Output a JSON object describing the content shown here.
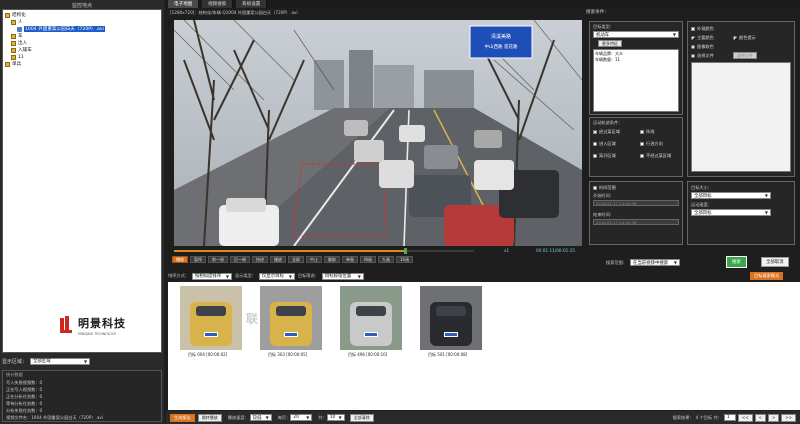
{
  "left_panel": {
    "title": "监控地点",
    "tree": [
      {
        "label": "结构化",
        "level": 0,
        "icon": "folder-icon"
      },
      {
        "label": "人",
        "level": 1,
        "icon": "folder-icon"
      },
      {
        "label": "1004 外国重案公园白天（720P）.avi",
        "level": 2,
        "icon": "camera-icon",
        "selected": true
      },
      {
        "label": "车",
        "level": 1,
        "icon": "folder-icon"
      },
      {
        "label": "出入",
        "level": 1,
        "icon": "folder-icon"
      },
      {
        "label": "入辅车",
        "level": 1,
        "icon": "folder-icon"
      },
      {
        "label": "11",
        "level": 1,
        "icon": "folder-icon"
      },
      {
        "label": "单兵",
        "level": 0,
        "icon": "folder-icon"
      }
    ],
    "logo": {
      "cn": "明景科技",
      "en": "MINGJING TECHNOLOGY"
    },
    "show_region_label": "显示区域：",
    "show_region_value": "全部区域",
    "stats_title": "统计数据",
    "stats": [
      {
        "label": "写入失败视频数：",
        "value": "0"
      },
      {
        "label": "正在写入视频数：",
        "value": "0"
      },
      {
        "label": "正在分析任务数：",
        "value": "0"
      },
      {
        "label": "等待分析任务数：",
        "value": "0"
      },
      {
        "label": "分析失败任务数：",
        "value": "0"
      },
      {
        "label": "视频文件名：",
        "value": "1004 外国重案公园白天（720P）.avi"
      }
    ]
  },
  "tabs": [
    {
      "label": "电子地图",
      "active": true
    },
    {
      "label": "视频搜索",
      "active": false
    },
    {
      "label": "系统设置",
      "active": false
    }
  ],
  "video": {
    "title": "[1280x720]：结构化/车辆-Q1004 外国重案公园白天（720P）.avi",
    "sign_line1": "清溪美路",
    "sign_line2": "中山西路  莲花路",
    "progress": 0.77,
    "speed": "x1",
    "time": "00:01:11/00:01:25"
  },
  "controls": [
    "播放",
    "暂停",
    "前一帧",
    "后一帧",
    "快进",
    "慢放",
    "全屏",
    "中止",
    "截取",
    "单画",
    "四画",
    "九画",
    "16画"
  ],
  "right_panel": {
    "title": "搜索条件：",
    "target_type_label": "目标类型：",
    "target_type_value": "机动车",
    "more_features_btn": "更多特征",
    "plate_label": "车辆品牌：大众",
    "plate_count": "车辆数量：11",
    "region_cond_label": "运动轨迹条件：",
    "checks": [
      {
        "label": "经过某区域",
        "on": true
      },
      {
        "label": "拌线",
        "on": false
      },
      {
        "label": "进入区域",
        "on": false
      },
      {
        "label": "行进方向",
        "on": false
      },
      {
        "label": "离开区域",
        "on": false
      },
      {
        "label": "不经过某区域",
        "on": false
      }
    ],
    "time_range_label": "时间范围",
    "start_label": "开始时间：",
    "start_value": "2018-01-17 14:45:36",
    "end_label": "结束时间：",
    "end_value": "2018-01-17 14:45:36",
    "color_checks": [
      {
        "label": "外观颜色",
        "on": false
      }
    ],
    "color_radios": [
      {
        "label": "主要颜色",
        "on": true
      },
      {
        "label": "颜色提示",
        "on": true
      },
      {
        "label": "图像取色",
        "on": false
      },
      {
        "label": "选择文件",
        "on": false
      }
    ],
    "file_btn": "选择文件",
    "size_label": "目标大小：",
    "size_value1": "全部目标",
    "size_label2": "运动速度：",
    "size_value2": "全部目标"
  },
  "search_row": {
    "range_label": "搜索范围：",
    "range_value": "在当前视频中搜索",
    "search_btn": "搜索",
    "clear_btn": "全部取消",
    "wizard_btn": "目标搜索模式"
  },
  "filter_row": {
    "sort_label": "排序方式：",
    "sort_value": "按相似度排序",
    "display_label": "显示类型：",
    "display_value": "仅显示目标",
    "filter_label": "目标筛选：",
    "filter_value": "目标按钮位置"
  },
  "results": [
    {
      "label": "目标 004 [00:00:02]"
    },
    {
      "label": "目标 303 [00:00:05]"
    },
    {
      "label": "目标 496 [00:00:10]"
    },
    {
      "label": "目标 501 [00:00:08]"
    }
  ],
  "watermark": "联 3  39",
  "bottom": {
    "btn1": "生成报告",
    "btn2": "跳转播放",
    "speed_label": "播放速度：",
    "speed_value": "较低",
    "count_label": "每页：",
    "count_value": "20",
    "pages_label": "共：",
    "pages_value": "10",
    "clear_btn": "全部清除",
    "result_info": "搜索结果：",
    "result_count": "4 个目标 共：",
    "page_value": "1",
    "pager": [
      "<<",
      "<",
      ">",
      ">>"
    ]
  },
  "colors": {
    "orange": "#d9731f",
    "green": "#3aa64a",
    "selection": "#1b5cc8",
    "sign_blue": "#1e4fb8"
  }
}
